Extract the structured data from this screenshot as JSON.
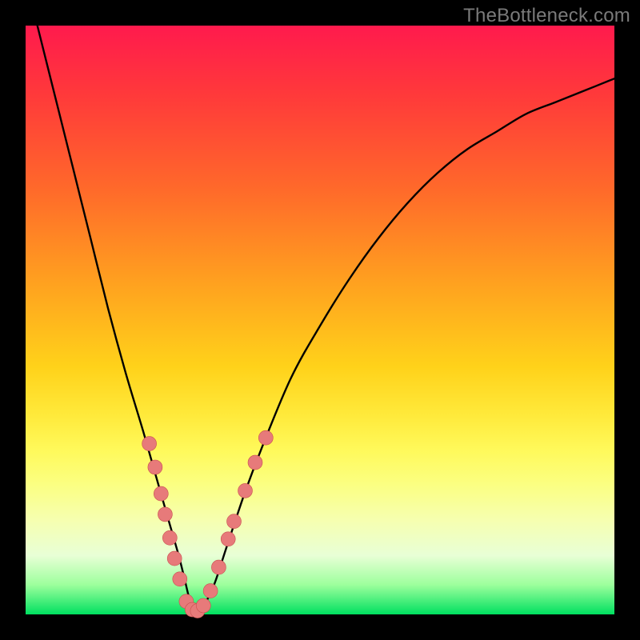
{
  "watermark": "TheBottleneck.com",
  "colors": {
    "frame": "#000000",
    "curve": "#000000",
    "dot_fill": "#e77a7a",
    "dot_stroke": "#c94f4f"
  },
  "chart_data": {
    "type": "line",
    "title": "",
    "xlabel": "",
    "ylabel": "",
    "xlim": [
      0,
      100
    ],
    "ylim": [
      0,
      100
    ],
    "note": "No axes, ticks, or legend visible. Values estimated from pixel positions; y measured upward from bottom of plot area.",
    "series": [
      {
        "name": "bottleneck-curve",
        "x": [
          2,
          5,
          8,
          11,
          14,
          17,
          20,
          22,
          24,
          26,
          27,
          28,
          29,
          30,
          32,
          34,
          37,
          40,
          45,
          50,
          55,
          60,
          65,
          70,
          75,
          80,
          85,
          90,
          95,
          100
        ],
        "y": [
          100,
          88,
          76,
          64,
          52,
          41,
          31,
          24,
          17,
          10,
          6,
          2,
          0,
          1,
          5,
          11,
          20,
          28,
          40,
          49,
          57,
          64,
          70,
          75,
          79,
          82,
          85,
          87,
          89,
          91
        ]
      }
    ],
    "markers": [
      {
        "name": "left-cluster",
        "x": 21.0,
        "y": 29.0
      },
      {
        "name": "left-cluster",
        "x": 22.0,
        "y": 25.0
      },
      {
        "name": "left-cluster",
        "x": 23.0,
        "y": 20.5
      },
      {
        "name": "left-cluster",
        "x": 23.7,
        "y": 17.0
      },
      {
        "name": "left-cluster",
        "x": 24.5,
        "y": 13.0
      },
      {
        "name": "left-cluster",
        "x": 25.3,
        "y": 9.5
      },
      {
        "name": "left-cluster",
        "x": 26.2,
        "y": 6.0
      },
      {
        "name": "bottom",
        "x": 27.3,
        "y": 2.2
      },
      {
        "name": "bottom",
        "x": 28.3,
        "y": 0.8
      },
      {
        "name": "bottom",
        "x": 29.2,
        "y": 0.6
      },
      {
        "name": "bottom",
        "x": 30.2,
        "y": 1.5
      },
      {
        "name": "right-cluster",
        "x": 31.4,
        "y": 4.0
      },
      {
        "name": "right-cluster",
        "x": 32.8,
        "y": 8.0
      },
      {
        "name": "right-cluster",
        "x": 34.4,
        "y": 12.8
      },
      {
        "name": "right-cluster",
        "x": 35.4,
        "y": 15.8
      },
      {
        "name": "right-cluster",
        "x": 37.3,
        "y": 21.0
      },
      {
        "name": "right-cluster",
        "x": 39.0,
        "y": 25.8
      },
      {
        "name": "right-cluster",
        "x": 40.8,
        "y": 30.0
      }
    ]
  }
}
